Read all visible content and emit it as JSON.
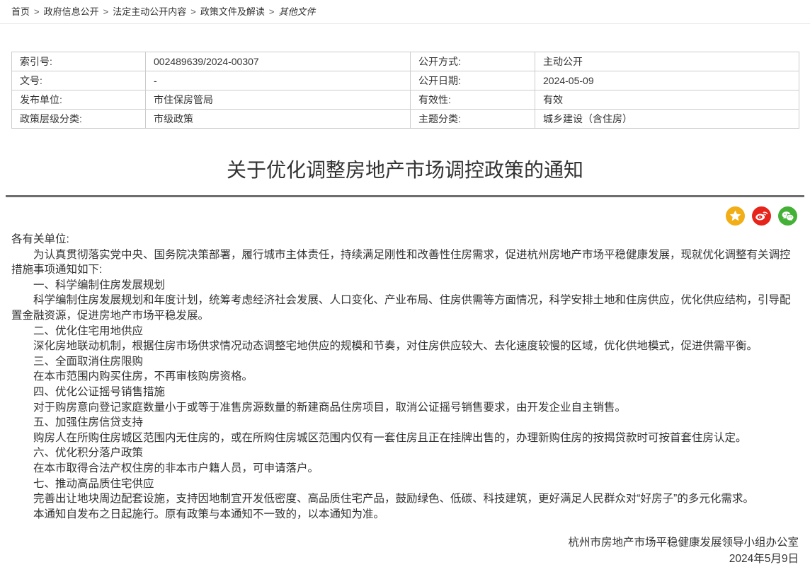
{
  "breadcrumb": {
    "separator": ">",
    "items": [
      "首页",
      "政府信息公开",
      "法定主动公开内容",
      "政策文件及解读",
      "其他文件"
    ]
  },
  "meta_table": {
    "rows": [
      [
        "索引号:",
        "002489639/2024-00307",
        "公开方式:",
        "主动公开"
      ],
      [
        "文号:",
        "-",
        "公开日期:",
        "2024-05-09"
      ],
      [
        "发布单位:",
        "市住保房管局",
        "有效性:",
        "有效"
      ],
      [
        "政策层级分类:",
        "市级政策",
        "主题分类:",
        "城乡建设（含住房）"
      ]
    ]
  },
  "article": {
    "title": "关于优化调整房地产市场调控政策的通知",
    "share_icons": [
      {
        "name": "qzone-share",
        "color": "#f2ae17"
      },
      {
        "name": "weibo-share",
        "color": "#e6241b"
      },
      {
        "name": "wechat-share",
        "color": "#43b036"
      }
    ],
    "salutation": "各有关单位:",
    "paragraphs": [
      "为认真贯彻落实党中央、国务院决策部署，履行城市主体责任，持续满足刚性和改善性住房需求，促进杭州房地产市场平稳健康发展，现就优化调整有关调控措施事项通知如下:",
      "一、科学编制住房发展规划",
      "科学编制住房发展规划和年度计划，统筹考虑经济社会发展、人口变化、产业布局、住房供需等方面情况，科学安排土地和住房供应，优化供应结构，引导配置金融资源，促进房地产市场平稳发展。",
      "二、优化住宅用地供应",
      "深化房地联动机制，根据住房市场供求情况动态调整宅地供应的规模和节奏，对住房供应较大、去化速度较慢的区域，优化供地模式，促进供需平衡。",
      "三、全面取消住房限购",
      "在本市范围内购买住房，不再审核购房资格。",
      "四、优化公证摇号销售措施",
      "对于购房意向登记家庭数量小于或等于准售房源数量的新建商品住房项目，取消公证摇号销售要求，由开发企业自主销售。",
      "五、加强住房信贷支持",
      "购房人在所购住房城区范围内无住房的，或在所购住房城区范围内仅有一套住房且正在挂牌出售的，办理新购住房的按揭贷款时可按首套住房认定。",
      "六、优化积分落户政策",
      "在本市取得合法产权住房的非本市户籍人员，可申请落户。",
      "七、推动高品质住宅供应",
      "完善出让地块周边配套设施，支持因地制宜开发低密度、高品质住宅产品，鼓励绿色、低碳、科技建筑，更好满足人民群众对“好房子”的多元化需求。",
      "本通知自发布之日起施行。原有政策与本通知不一致的，以本通知为准。"
    ],
    "signature": "杭州市房地产市场平稳健康发展领导小组办公室",
    "date": "2024年5月9日"
  }
}
